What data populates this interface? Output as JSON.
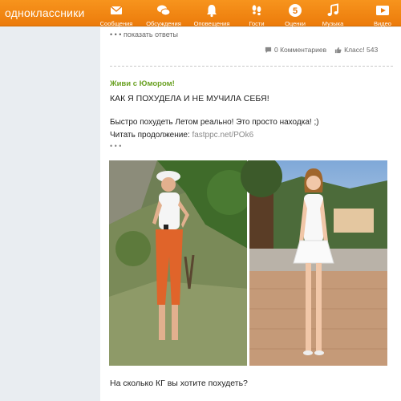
{
  "header": {
    "site_name": "одноклассники",
    "nav": [
      {
        "label": "Сообщения",
        "icon": "envelope-icon"
      },
      {
        "label": "Обсуждения",
        "icon": "chat-bubbles-icon"
      },
      {
        "label": "Оповещения",
        "icon": "bell-icon"
      },
      {
        "label": "Гости",
        "icon": "footprints-icon"
      },
      {
        "label": "Оценки",
        "icon": "rating-five-icon"
      },
      {
        "label": "Музыка",
        "icon": "music-note-icon"
      },
      {
        "label": "Видео",
        "icon": "video-play-icon"
      }
    ]
  },
  "post_top": {
    "show_answers": "• • • показать ответы",
    "comments": "0 Комментариев",
    "likes": "Класс! 543"
  },
  "post": {
    "group": "Живи с Юмором!",
    "title": "КАК Я ПОХУДЕЛА И НЕ МУЧИЛА СЕБЯ!",
    "line1": "Быстро похудеть Летом реально! Это просто находка! ;)",
    "line2_prefix": "Читать продолжение: ",
    "link": "fastppc.net/POk6",
    "more": "• • •",
    "question": "На сколько КГ вы хотите похудеть?"
  },
  "colors": {
    "header_orange": "#f28b16",
    "group_green": "#6aa122",
    "page_bg": "#edf0f3"
  }
}
